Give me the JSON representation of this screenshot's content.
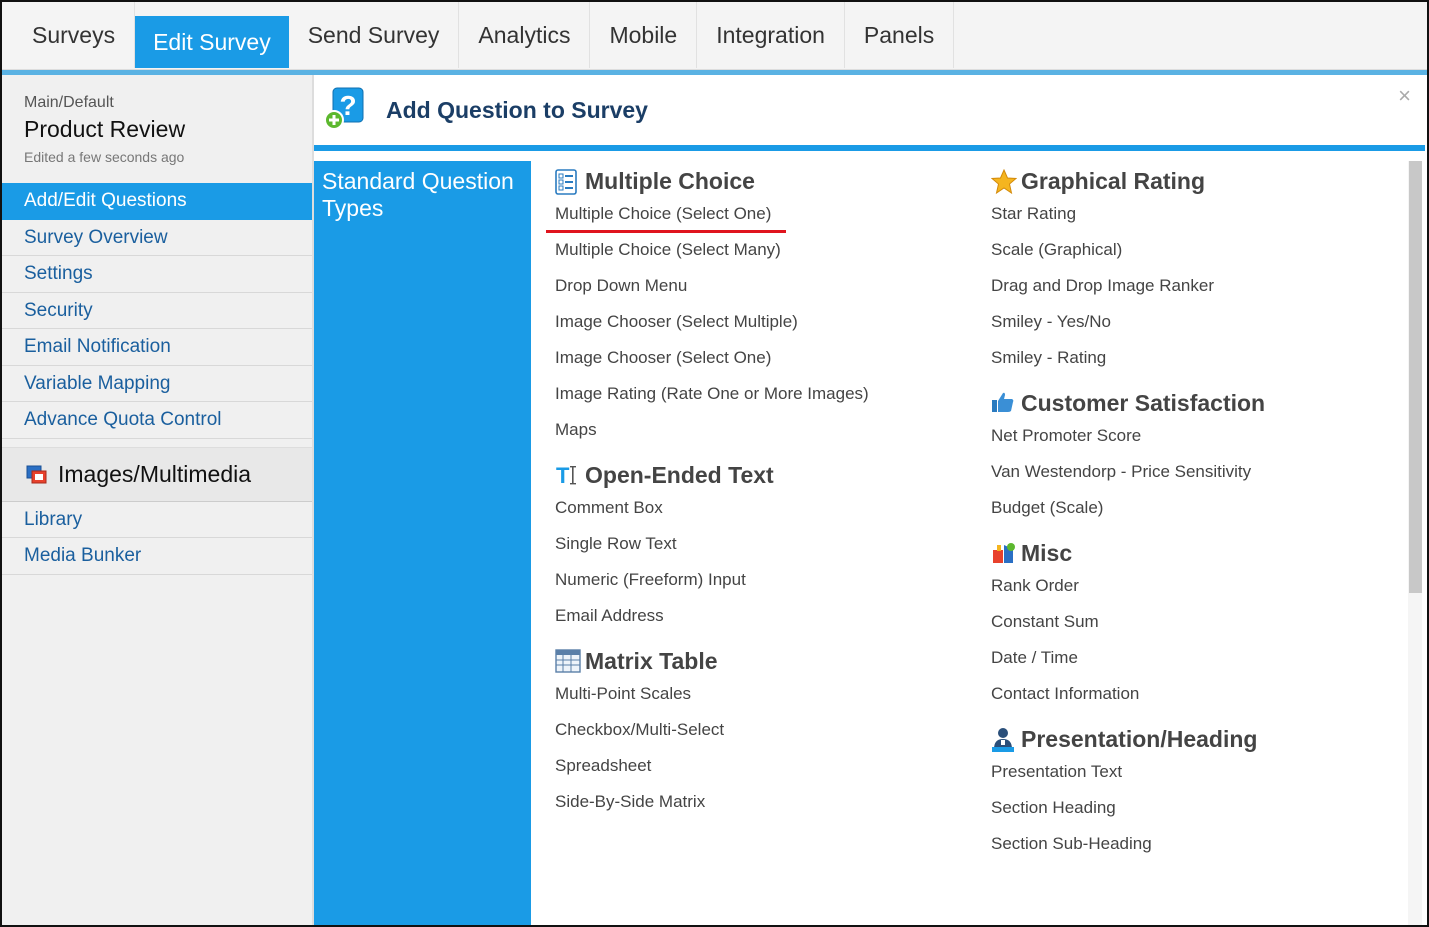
{
  "topnav": {
    "tabs": [
      {
        "label": "Surveys",
        "active": false
      },
      {
        "label": "Edit Survey",
        "active": true
      },
      {
        "label": "Send Survey",
        "active": false
      },
      {
        "label": "Analytics",
        "active": false
      },
      {
        "label": "Mobile",
        "active": false
      },
      {
        "label": "Integration",
        "active": false
      },
      {
        "label": "Panels",
        "active": false
      }
    ]
  },
  "sidebar": {
    "path": "Main/Default",
    "survey_name": "Product Review",
    "edited": "Edited a few seconds ago",
    "items": [
      {
        "label": "Add/Edit Questions",
        "active": true
      },
      {
        "label": "Survey Overview",
        "active": false
      },
      {
        "label": "Settings",
        "active": false
      },
      {
        "label": "Security",
        "active": false
      },
      {
        "label": "Email Notification",
        "active": false
      },
      {
        "label": "Variable Mapping",
        "active": false
      },
      {
        "label": "Advance Quota Control",
        "active": false
      }
    ],
    "media_header": "Images/Multimedia",
    "media_items": [
      {
        "label": "Library"
      },
      {
        "label": "Media Bunker"
      }
    ]
  },
  "dialog": {
    "title": "Add Question to Survey",
    "close_glyph": "×",
    "panel_label": "Standard Question Types",
    "col1": [
      {
        "title": "Multiple Choice",
        "icon": "list-icon",
        "items": [
          "Multiple Choice (Select One)",
          "Multiple Choice (Select Many)",
          "Drop Down Menu",
          "Image Chooser (Select Multiple)",
          "Image Chooser (Select One)",
          "Image Rating (Rate One or More Images)",
          "Maps"
        ]
      },
      {
        "title": "Open-Ended Text",
        "icon": "text-cursor-icon",
        "items": [
          "Comment Box",
          "Single Row Text",
          "Numeric (Freeform) Input",
          "Email Address"
        ]
      },
      {
        "title": "Matrix Table",
        "icon": "table-icon",
        "items": [
          "Multi-Point Scales",
          "Checkbox/Multi-Select",
          "Spreadsheet",
          "Side-By-Side Matrix"
        ]
      }
    ],
    "col2": [
      {
        "title": "Graphical Rating",
        "icon": "star-icon",
        "items": [
          "Star Rating",
          "Scale (Graphical)",
          "Drag and Drop Image Ranker",
          "Smiley - Yes/No",
          "Smiley - Rating"
        ]
      },
      {
        "title": "Customer Satisfaction",
        "icon": "thumbs-up-icon",
        "items": [
          "Net Promoter Score",
          "Van Westendorp - Price Sensitivity",
          "Budget (Scale)"
        ]
      },
      {
        "title": "Misc",
        "icon": "misc-icon",
        "items": [
          "Rank Order",
          "Constant Sum",
          "Date / Time",
          "Contact Information"
        ]
      },
      {
        "title": "Presentation/Heading",
        "icon": "presenter-icon",
        "items": [
          "Presentation Text",
          "Section Heading",
          "Section Sub-Heading"
        ]
      }
    ]
  },
  "colors": {
    "accent": "#1a9be6",
    "link": "#1a5f9e",
    "underline": "#e0141e"
  }
}
